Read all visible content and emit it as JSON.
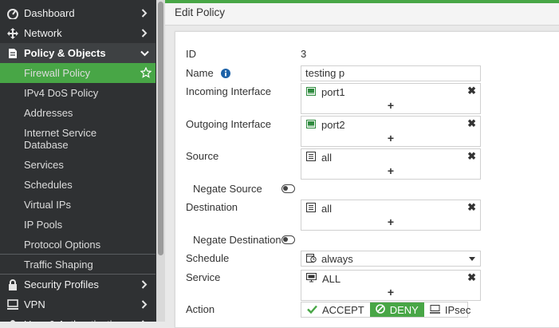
{
  "sidebar": {
    "top_items": [
      {
        "label": "Dashboard",
        "icon": "dashboard-icon"
      },
      {
        "label": "Network",
        "icon": "network-icon"
      },
      {
        "label": "Policy & Objects",
        "icon": "policy-icon"
      }
    ],
    "sub_items": [
      {
        "label": "Firewall Policy"
      },
      {
        "label": "IPv4 DoS Policy"
      },
      {
        "label": "Addresses"
      },
      {
        "label": "Internet Service",
        "label2": "Database"
      },
      {
        "label": "Services"
      },
      {
        "label": "Schedules"
      },
      {
        "label": "Virtual IPs"
      },
      {
        "label": "IP Pools"
      },
      {
        "label": "Protocol Options"
      },
      {
        "label": "Traffic Shaping"
      }
    ],
    "bottom_items": [
      {
        "label": "Security Profiles",
        "icon": "lock-icon"
      },
      {
        "label": "VPN",
        "icon": "monitor-icon"
      },
      {
        "label": "User & Authentication",
        "icon": "user-icon"
      }
    ]
  },
  "page": {
    "title": "Edit Policy"
  },
  "form": {
    "id": {
      "label": "ID",
      "value": "3"
    },
    "name": {
      "label": "Name",
      "value": "testing p"
    },
    "incoming": {
      "label": "Incoming Interface",
      "value": "port1"
    },
    "outgoing": {
      "label": "Outgoing Interface",
      "value": "port2"
    },
    "source": {
      "label": "Source",
      "value": "all"
    },
    "negate_source": {
      "label": "Negate Source"
    },
    "destination": {
      "label": "Destination",
      "value": "all"
    },
    "negate_destination": {
      "label": "Negate Destination"
    },
    "schedule": {
      "label": "Schedule",
      "value": "always"
    },
    "service": {
      "label": "Service",
      "value": "ALL"
    },
    "action": {
      "label": "Action",
      "options": [
        "ACCEPT",
        "DENY",
        "IPsec"
      ],
      "selected": "DENY"
    }
  },
  "colors": {
    "accent": "#48a646",
    "sidebar_bg": "#2f3133"
  }
}
